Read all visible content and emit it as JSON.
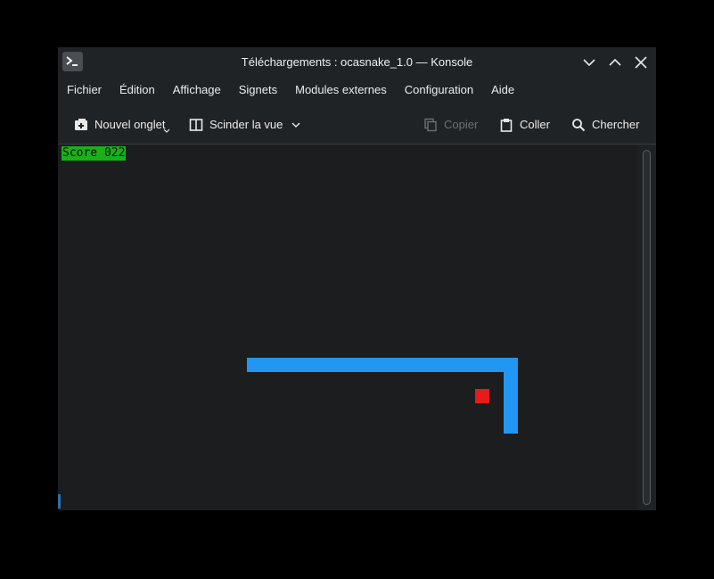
{
  "window": {
    "title": "Téléchargements : ocasnake_1.0 — Konsole",
    "controls": [
      "minimize-icon",
      "maximize-icon",
      "close-icon"
    ]
  },
  "menu": {
    "items": [
      "Fichier",
      "Édition",
      "Affichage",
      "Signets",
      "Modules externes",
      "Configuration",
      "Aide"
    ]
  },
  "toolbar": {
    "new_tab": "Nouvel onglet",
    "split_view": "Scinder la vue",
    "copy": "Copier",
    "paste": "Coller",
    "find": "Chercher"
  },
  "game": {
    "score_text": "Score 022",
    "colors": {
      "score_bg": "#18b218",
      "snake": "#2196f3",
      "food": "#e81a1a"
    }
  }
}
